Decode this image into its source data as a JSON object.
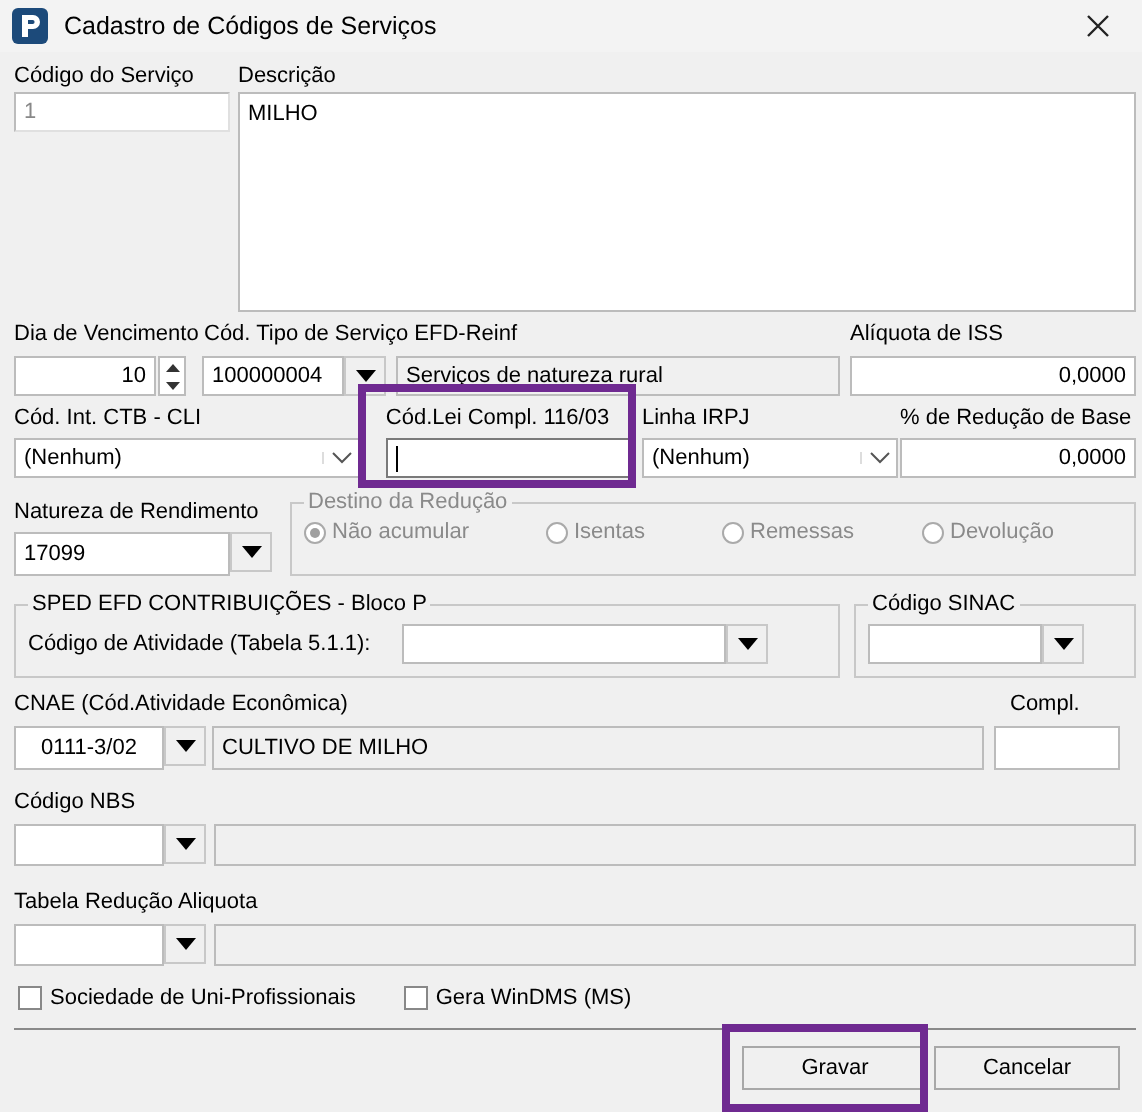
{
  "window": {
    "title": "Cadastro de Códigos de Serviços"
  },
  "service_code": {
    "label": "Código do Serviço",
    "value": "1",
    "disabled": true
  },
  "description": {
    "label": "Descrição",
    "value": "MILHO"
  },
  "due_day": {
    "label": "Dia de Vencimento",
    "value": "10"
  },
  "reinf_service_type": {
    "label": "Cód. Tipo de Serviço EFD-Reinf",
    "value": "100000004",
    "description": "Serviços de natureza rural"
  },
  "iss_rate": {
    "label": "Alíquota de ISS",
    "value": "0,0000"
  },
  "ctb_code": {
    "label": "Cód. Int. CTB - CLI",
    "value": "(Nenhum)"
  },
  "lc116_code": {
    "label": "Cód.Lei Compl. 116/03",
    "focused": true,
    "highlighted": true
  },
  "irpj_line": {
    "label": "Linha IRPJ",
    "value": "(Nenhum)"
  },
  "base_reduction": {
    "label": "% de Redução de Base",
    "value": "0,0000"
  },
  "income_nature": {
    "label": "Natureza de Rendimento",
    "value": "17099"
  },
  "reduction_destination": {
    "title": "Destino da Redução",
    "disabled": true,
    "options": [
      {
        "label": "Não acumular",
        "selected": true
      },
      {
        "label": "Isentas",
        "selected": false
      },
      {
        "label": "Remessas",
        "selected": false
      },
      {
        "label": "Devolução",
        "selected": false
      }
    ]
  },
  "sped_block_p": {
    "title": "SPED EFD CONTRIBUIÇÕES - Bloco P",
    "activity_label": "Código de Atividade (Tabela 5.1.1):"
  },
  "sinac": {
    "title": "Código SINAC"
  },
  "cnae": {
    "label": "CNAE (Cód.Atividade Econômica)",
    "value": "0111-3/02",
    "description": "CULTIVO DE MILHO"
  },
  "complement": {
    "label": "Compl."
  },
  "nbs": {
    "label": "Código NBS"
  },
  "reduction_table": {
    "label": "Tabela Redução Aliquota"
  },
  "checkboxes": [
    {
      "label": "Sociedade de Uni-Profissionais",
      "checked": false
    },
    {
      "label": "Gera WinDMS (MS)",
      "checked": false
    }
  ],
  "buttons": [
    {
      "label": "Gravar",
      "highlighted": true
    },
    {
      "label": "Cancelar",
      "highlighted": false
    }
  ]
}
